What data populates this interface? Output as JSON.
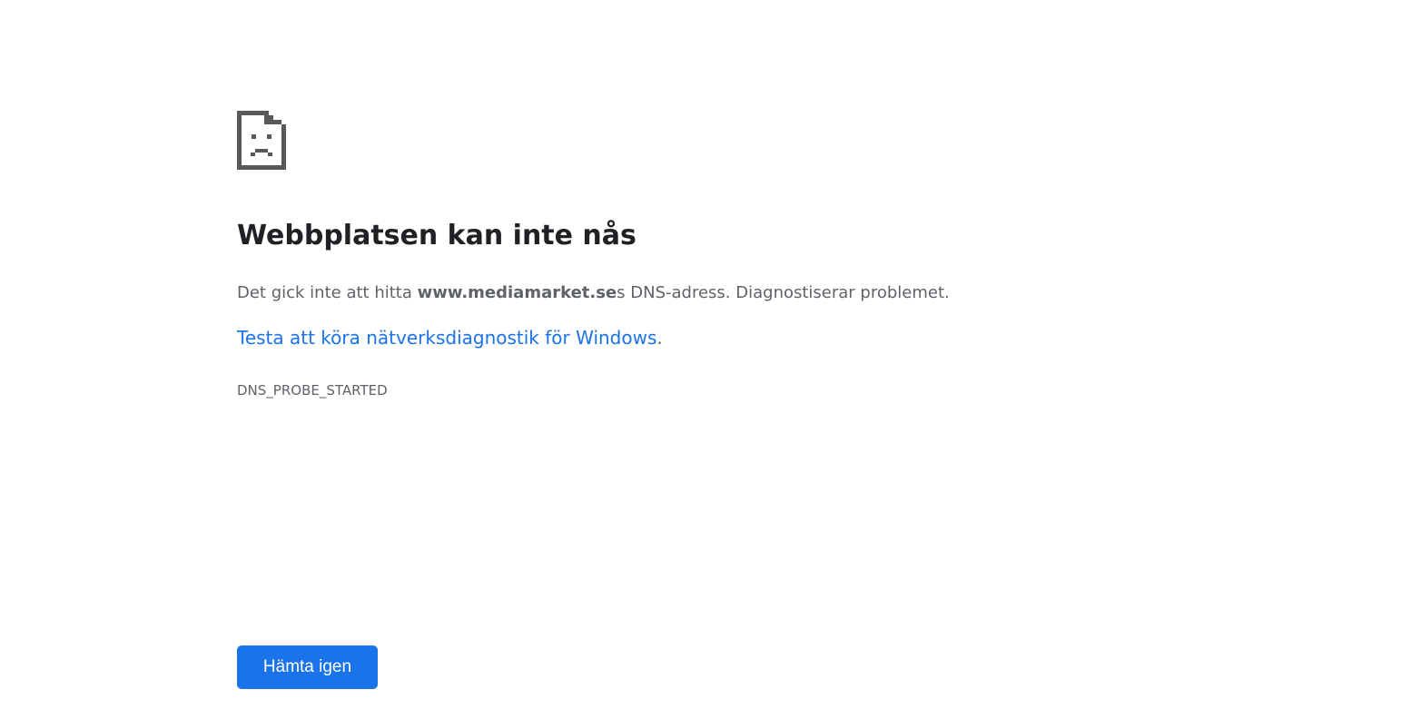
{
  "error_page": {
    "icon": "sad-page-icon",
    "title": "Webbplatsen kan inte nås",
    "message": {
      "prefix": "Det gick inte att hitta ",
      "domain": "www.mediamarket.se",
      "suffix": "s DNS-adress. Diagnostiserar problemet."
    },
    "diagnostics": {
      "link_text": "Testa att köra nätverksdiagnostik för Windows",
      "trailing": "."
    },
    "error_code": "DNS_PROBE_STARTED",
    "reload_label": "Hämta igen"
  },
  "colors": {
    "title": "#202124",
    "text": "#5f6368",
    "link": "#1a73e8",
    "button": "#1a73e8",
    "icon": "#595959"
  }
}
